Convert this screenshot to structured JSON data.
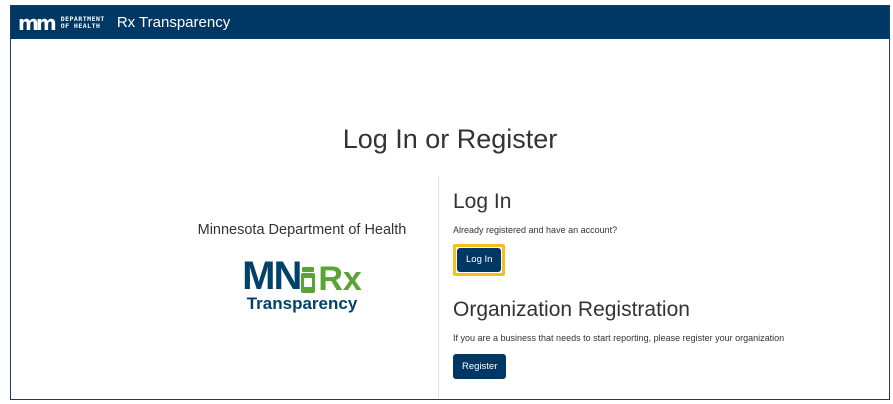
{
  "header": {
    "logo_mark": "m",
    "logo_line1": "DEPARTMENT",
    "logo_line2": "OF HEALTH",
    "app_title": "Rx Transparency",
    "background_color": "#003865"
  },
  "main": {
    "page_title": "Log In or Register",
    "left": {
      "department_name": "Minnesota Department of Health",
      "brand_logo": {
        "mn": "MN",
        "rx": "Rx",
        "subtitle": "Transparency"
      }
    },
    "login": {
      "title": "Log In",
      "description": "Already registered and have an account?",
      "button_label": "Log In",
      "highlight_color": "#f6bf1a"
    },
    "registration": {
      "title": "Organization Registration",
      "description": "If you are a business that needs to start reporting, please register your organization",
      "button_label": "Register"
    }
  }
}
